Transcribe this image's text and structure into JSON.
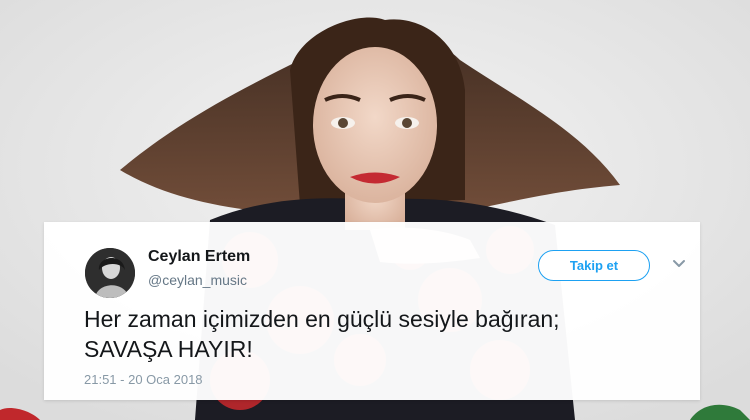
{
  "tweet": {
    "author_name": "Ceylan Ertem",
    "author_handle": "@ceylan_music",
    "follow_label": "Takip et",
    "text_line1": "Her zaman içimizden en güçlü sesiyle bağıran;",
    "text_line2": "SAVAŞA HAYIR!",
    "timestamp": "21:51 - 20 Oca 2018"
  },
  "icons": {
    "caret": "chevron-down-icon",
    "avatar": "avatar"
  },
  "colors": {
    "accent": "#1da1f2",
    "text": "#14171a",
    "muted": "#657786"
  }
}
